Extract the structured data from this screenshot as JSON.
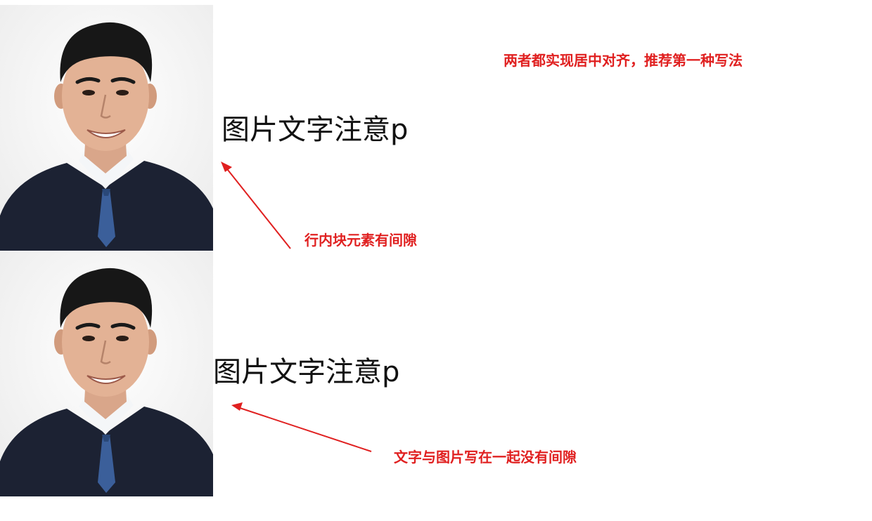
{
  "colors": {
    "annotation": "#e02020",
    "text": "#111111",
    "background": "#ffffff"
  },
  "demo": {
    "text_inline_block": "图片文字注意p",
    "text_inline": "图片文字注意p"
  },
  "annotations": {
    "top_note": "两者都实现居中对齐，推荐第一种写法",
    "middle_note": "行内块元素有间隙",
    "bottom_note": "文字与图片写在一起没有间隙"
  },
  "images": [
    {
      "name": "portrait-photo",
      "icon": "portrait-image"
    },
    {
      "name": "portrait-photo",
      "icon": "portrait-image"
    }
  ]
}
